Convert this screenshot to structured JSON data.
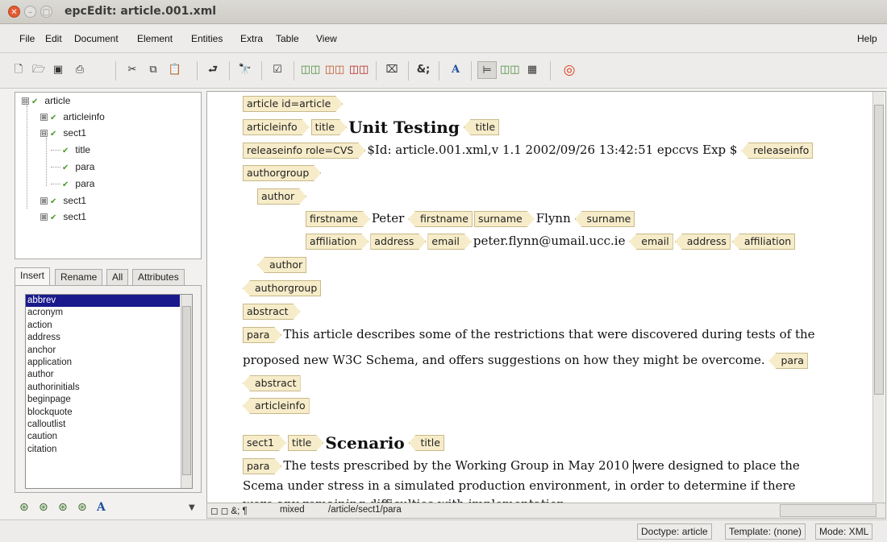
{
  "window": {
    "title": "epcEdit: article.001.xml"
  },
  "menu": {
    "items": [
      "File",
      "Edit",
      "Document",
      "Element",
      "Entities",
      "Extra",
      "Table",
      "View"
    ],
    "help": "Help"
  },
  "toolbar": {
    "icons": [
      "new-document-icon",
      "open-folder-icon",
      "save-icon",
      "print-icon",
      "cut-icon",
      "copy-icon",
      "paste-icon",
      "undo-icon",
      "find-icon",
      "validate-icon",
      "insert-element-before-icon",
      "insert-element-after-icon",
      "delete-element-icon",
      "attributes-icon",
      "entity-icon",
      "font-icon",
      "tree-view-icon",
      "tag-view-icon",
      "table-view-icon",
      "help-lifebuoy-icon"
    ]
  },
  "tree": {
    "nodes": [
      {
        "label": "article",
        "expander": "⊟"
      },
      {
        "label": "articleinfo",
        "expander": "⊞"
      },
      {
        "label": "sect1",
        "expander": "⊟"
      },
      {
        "label": "title",
        "expander": ""
      },
      {
        "label": "para",
        "expander": ""
      },
      {
        "label": "para",
        "expander": ""
      },
      {
        "label": "sect1",
        "expander": "⊞"
      },
      {
        "label": "sect1",
        "expander": "⊞"
      }
    ]
  },
  "tabs": [
    "Insert",
    "Rename",
    "All",
    "Attributes"
  ],
  "elements": [
    "abbrev",
    "acronym",
    "action",
    "address",
    "anchor",
    "application",
    "author",
    "authorinitials",
    "beginpage",
    "blockquote",
    "calloutlist",
    "caution",
    "citation"
  ],
  "doc": {
    "article_tag": "article id=article",
    "articleinfo_tag": "articleinfo",
    "title_tag": "title",
    "title1": "Unit Testing",
    "releaseinfo_tag": "releaseinfo role=CVS",
    "releaseinfo_text": "$Id: article.001.xml,v 1.1 2002/09/26 13:42:51 epccvs Exp $",
    "releaseinfo_close": "releaseinfo",
    "authorgroup_tag": "authorgroup",
    "author_tag": "author",
    "firstname_tag": "firstname",
    "firstname_text": "Peter",
    "surname_tag": "surname",
    "surname_text": "Flynn",
    "affiliation_tag": "affiliation",
    "address_tag": "address",
    "email_tag": "email",
    "email_text": "peter.flynn@umail.ucc.ie",
    "abstract_tag": "abstract",
    "para_tag": "para",
    "para1_line1": "This article describes some of the restrictions that were discovered during tests of the",
    "para1_line2": "proposed new W3C Schema, and offers suggestions on how they might be overcome.",
    "sect1_tag": "sect1",
    "title2": "Scenario",
    "para2_line1a": "The tests prescribed by the Working Group in May 2010 ",
    "para2_line1b": "were designed to place the",
    "para2_line2": "Scema under stress in a simulated production environment, in order to determine if there",
    "para2_line3": "were any remaining difficulties with implementation."
  },
  "statusbar": {
    "glyphs": "◻ ◻ &; ¶",
    "mode": "mixed",
    "path": "/article/sect1/para"
  },
  "footer": {
    "doctype": "Doctype: article",
    "template": "Template: (none)",
    "mode": "Mode: XML"
  }
}
